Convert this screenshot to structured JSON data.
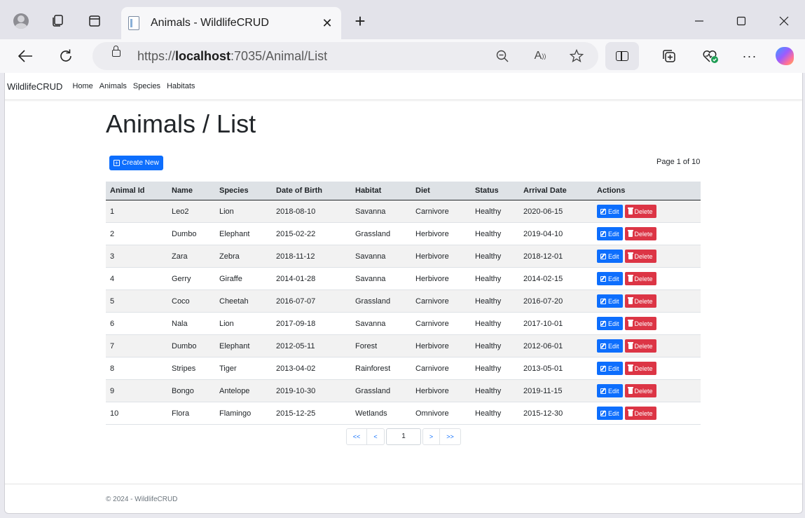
{
  "browser": {
    "tab_title": "Animals - WildlifeCRUD",
    "new_tab_label": "+",
    "url_prefix": "https://",
    "url_host": "localhost",
    "url_rest": ":7035/Animal/List"
  },
  "site": {
    "brand": "WildlifeCRUD",
    "nav": [
      "Home",
      "Animals",
      "Species",
      "Habitats"
    ]
  },
  "page": {
    "title": "Animals / List",
    "create_label": "Create New",
    "page_info": "Page 1 of 10"
  },
  "table": {
    "columns": [
      "Animal Id",
      "Name",
      "Species",
      "Date of Birth",
      "Habitat",
      "Diet",
      "Status",
      "Arrival Date",
      "Actions"
    ],
    "rows": [
      [
        "1",
        "Leo2",
        "Lion",
        "2018-08-10",
        "Savanna",
        "Carnivore",
        "Healthy",
        "2020-06-15"
      ],
      [
        "2",
        "Dumbo",
        "Elephant",
        "2015-02-22",
        "Grassland",
        "Herbivore",
        "Healthy",
        "2019-04-10"
      ],
      [
        "3",
        "Zara",
        "Zebra",
        "2018-11-12",
        "Savanna",
        "Herbivore",
        "Healthy",
        "2018-12-01"
      ],
      [
        "4",
        "Gerry",
        "Giraffe",
        "2014-01-28",
        "Savanna",
        "Herbivore",
        "Healthy",
        "2014-02-15"
      ],
      [
        "5",
        "Coco",
        "Cheetah",
        "2016-07-07",
        "Grassland",
        "Carnivore",
        "Healthy",
        "2016-07-20"
      ],
      [
        "6",
        "Nala",
        "Lion",
        "2017-09-18",
        "Savanna",
        "Carnivore",
        "Healthy",
        "2017-10-01"
      ],
      [
        "7",
        "Dumbo",
        "Elephant",
        "2012-05-11",
        "Forest",
        "Herbivore",
        "Healthy",
        "2012-06-01"
      ],
      [
        "8",
        "Stripes",
        "Tiger",
        "2013-04-02",
        "Rainforest",
        "Carnivore",
        "Healthy",
        "2013-05-01"
      ],
      [
        "9",
        "Bongo",
        "Antelope",
        "2019-10-30",
        "Grassland",
        "Herbivore",
        "Healthy",
        "2019-11-15"
      ],
      [
        "10",
        "Flora",
        "Flamingo",
        "2015-12-25",
        "Wetlands",
        "Omnivore",
        "Healthy",
        "2015-12-30"
      ]
    ],
    "edit_label": "Edit",
    "delete_label": "Delete"
  },
  "pager": {
    "first": "<<",
    "prev": "<",
    "current": "1",
    "next": ">",
    "last": ">>"
  },
  "footer": {
    "text": "© 2024 - WildlifeCRUD"
  },
  "colors": {
    "primary": "#0d6efd",
    "danger": "#dc3545",
    "header_bg": "#dee2e6"
  }
}
